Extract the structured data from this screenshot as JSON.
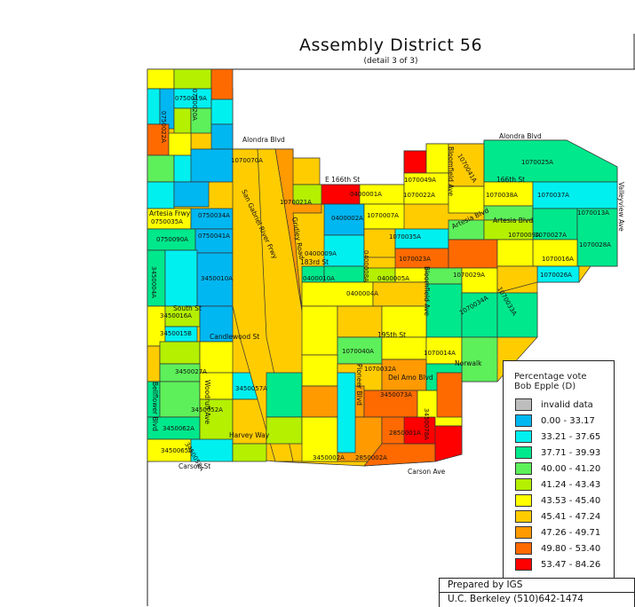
{
  "title": "Assembly District 56",
  "subtitle": "(detail 3 of 3)",
  "legend": {
    "title_line1": "Percentage vote",
    "title_line2": "Bob Epple (D)",
    "items": [
      {
        "label": "invalid data",
        "color": "#bdbdbd"
      },
      {
        "label": "0.00 - 33.17",
        "color": "#00b7f1"
      },
      {
        "label": "33.21 - 37.65",
        "color": "#00f0f0"
      },
      {
        "label": "37.71 - 39.93",
        "color": "#00e88c"
      },
      {
        "label": "40.00 - 41.20",
        "color": "#5df05a"
      },
      {
        "label": "41.24 - 43.43",
        "color": "#b4f000"
      },
      {
        "label": "43.53 - 45.40",
        "color": "#ffff00"
      },
      {
        "label": "45.41 - 47.24",
        "color": "#ffcc00"
      },
      {
        "label": "47.26 - 49.71",
        "color": "#ff9a00"
      },
      {
        "label": "49.80 - 53.40",
        "color": "#ff6a00"
      },
      {
        "label": "53.47 - 84.26",
        "color": "#ff0000"
      }
    ]
  },
  "credit": {
    "line1": "Prepared by IGS",
    "line2": "U.C. Berkeley (510)642-1474"
  },
  "streets": [
    "Alondra Blvd",
    "Alondra Blvd",
    "E 166th St",
    "166th St",
    "Artesia Frwy",
    "Artesia Blvd",
    "Artesia Blvd",
    "183rd St",
    "South St",
    "Candlewood St",
    "195th St",
    "Del Amo Blvd",
    "Harvey Way",
    "Carson St",
    "Carson Ave",
    "Bloomfield Ave",
    "Bloomfield Ave",
    "Gridley Road",
    "Pioneer Blvd",
    "San Gabriel River Frwy",
    "Woodruff Ave",
    "Bellflower Blvd",
    "Valleyview Ave",
    "Norwalk"
  ],
  "precincts": [
    "0750019A",
    "0750022A",
    "0750020A",
    "1070070A",
    "1070049A",
    "1070041A",
    "1070025A",
    "0750035A",
    "0750034A",
    "0400001A",
    "1070022A",
    "1070038A",
    "1070037A",
    "1070013A",
    "0750090A",
    "0750041A",
    "1070021A",
    "0400002A",
    "1070007A",
    "1070035A",
    "1070009A",
    "1070027A",
    "1070028A",
    "0400009A",
    "0400008A",
    "1070023A",
    "1070016A",
    "3450004A",
    "3450010A",
    "0400010A",
    "0400005A",
    "1070029A",
    "1070026A",
    "0400004A",
    "3450016A",
    "3450015B",
    "3450027A",
    "3450057A",
    "3450052A",
    "3450062A",
    "3450065A",
    "3450058A",
    "3450002A",
    "3450073A",
    "3450078A",
    "2850001A",
    "2850002A",
    "1070040A",
    "1070014A",
    "1070032A",
    "1070034A",
    "1070033A"
  ]
}
